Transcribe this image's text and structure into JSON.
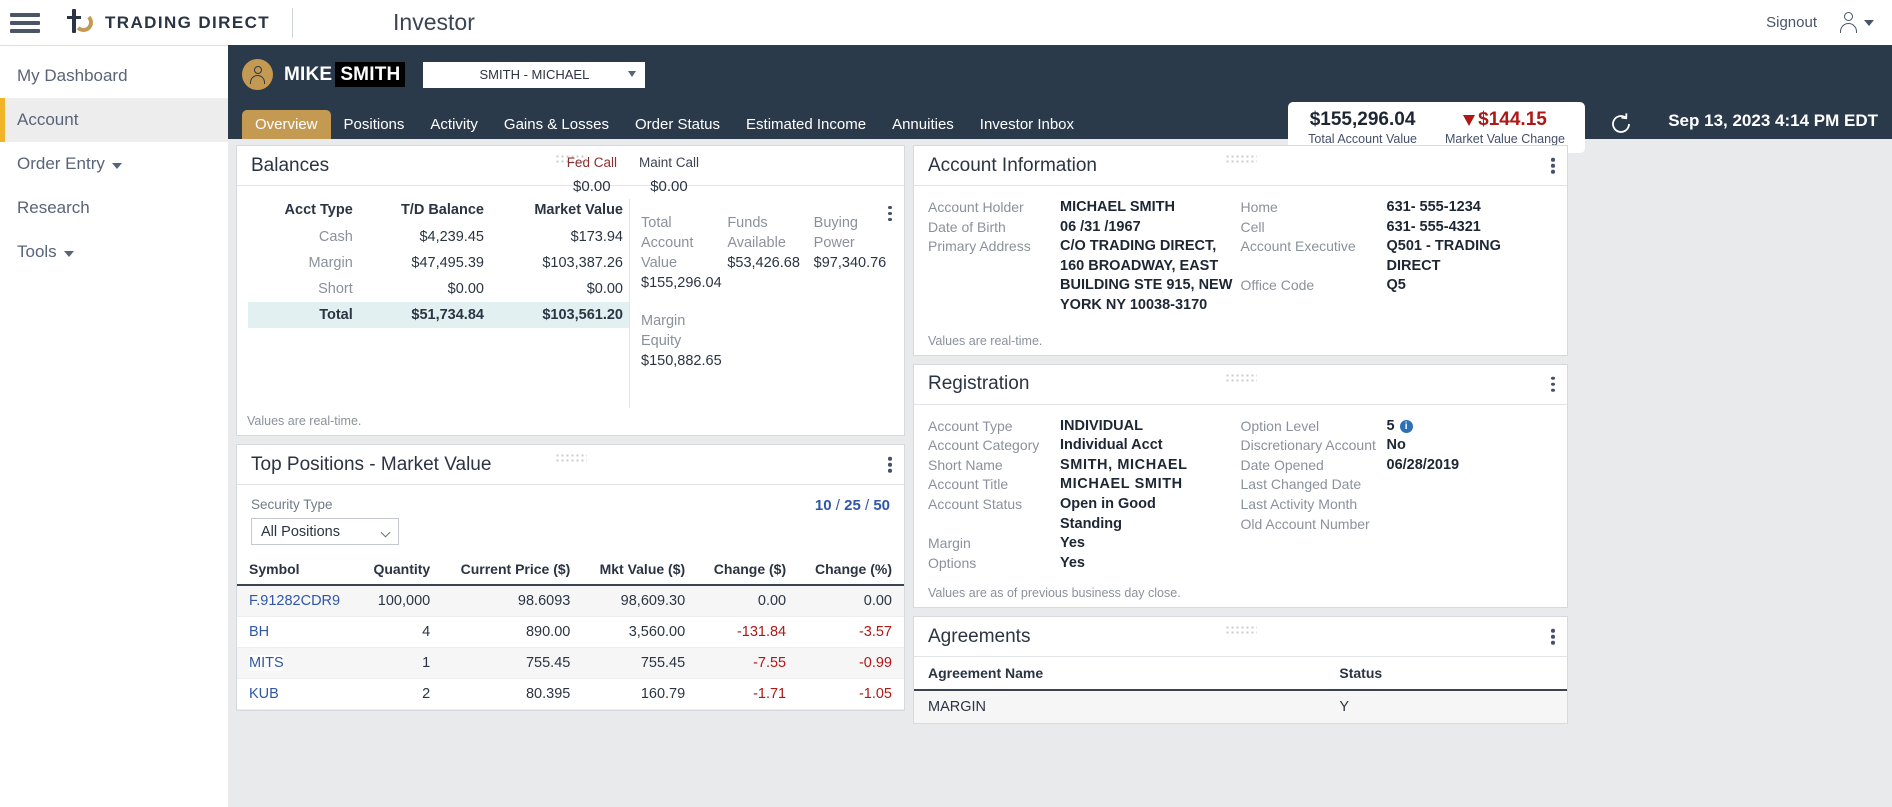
{
  "topbar": {
    "brand_name": "TRADING DIRECT",
    "app_title": "Investor",
    "signout_label": "Signout"
  },
  "sidebar": {
    "items": [
      {
        "label": "My Dashboard",
        "active": false,
        "caret": false
      },
      {
        "label": "Account",
        "active": true,
        "caret": false
      },
      {
        "label": "Order Entry",
        "active": false,
        "caret": true
      },
      {
        "label": "Research",
        "active": false,
        "caret": false
      },
      {
        "label": "Tools",
        "active": false,
        "caret": true
      }
    ]
  },
  "account_bar": {
    "name_first": "MIKE",
    "name_redacted": "SMITH",
    "account_select_value": "SMITH - MICHAEL",
    "total_account_value": "$155,296.04",
    "total_account_value_label": "Total Account Value",
    "market_value_change": "$144.15",
    "market_value_change_label": "Market Value Change",
    "timestamp": "Sep 13, 2023 4:14 PM EDT",
    "tabs": [
      {
        "label": "Overview",
        "active": true
      },
      {
        "label": "Positions",
        "active": false
      },
      {
        "label": "Activity",
        "active": false
      },
      {
        "label": "Gains & Losses",
        "active": false
      },
      {
        "label": "Order Status",
        "active": false
      },
      {
        "label": "Estimated Income",
        "active": false
      },
      {
        "label": "Annuities",
        "active": false
      },
      {
        "label": "Investor Inbox",
        "active": false
      }
    ]
  },
  "balances": {
    "title": "Balances",
    "fed_call_label": "Fed Call",
    "fed_call_value": "$0.00",
    "maint_call_label": "Maint Call",
    "maint_call_value": "$0.00",
    "columns": [
      "Acct Type",
      "T/D Balance",
      "Market Value"
    ],
    "rows": [
      {
        "type": "Cash",
        "td_balance": "$4,239.45",
        "market_value": "$173.94"
      },
      {
        "type": "Margin",
        "td_balance": "$47,495.39",
        "market_value": "$103,387.26"
      },
      {
        "type": "Short",
        "td_balance": "$0.00",
        "market_value": "$0.00"
      },
      {
        "type": "Total",
        "td_balance": "$51,734.84",
        "market_value": "$103,561.20"
      }
    ],
    "metrics": [
      {
        "label": "Total Account Value",
        "value": "$155,296.04"
      },
      {
        "label": "Funds Available",
        "value": "$53,426.68"
      },
      {
        "label": "Buying Power",
        "value": "$97,340.76"
      }
    ],
    "margin_equity_label": "Margin Equity",
    "margin_equity_value": "$150,882.65",
    "footnote": "Values are real-time."
  },
  "top_positions": {
    "title": "Top Positions - Market Value",
    "security_type_label": "Security Type",
    "security_type_value": "All Positions",
    "pager": {
      "p10": "10",
      "p25": "25",
      "p50": "50"
    },
    "columns": [
      "Symbol",
      "Quantity",
      "Current Price ($)",
      "Mkt Value ($)",
      "Change ($)",
      "Change (%)"
    ],
    "rows": [
      {
        "symbol": "F.91282CDR9",
        "quantity": "100,000",
        "price": "98.6093",
        "mkt_value": "98,609.30",
        "chg": "0.00",
        "chg_pct": "0.00",
        "neg": false
      },
      {
        "symbol": "BH",
        "quantity": "4",
        "price": "890.00",
        "mkt_value": "3,560.00",
        "chg": "-131.84",
        "chg_pct": "-3.57",
        "neg": true
      },
      {
        "symbol": "MITS",
        "quantity": "1",
        "price": "755.45",
        "mkt_value": "755.45",
        "chg": "-7.55",
        "chg_pct": "-0.99",
        "neg": true
      },
      {
        "symbol": "KUB",
        "quantity": "2",
        "price": "80.395",
        "mkt_value": "160.79",
        "chg": "-1.71",
        "chg_pct": "-1.05",
        "neg": true
      }
    ]
  },
  "account_information": {
    "title": "Account Information",
    "left": [
      {
        "key": "Account Holder",
        "value": "MICHAEL SMITH"
      },
      {
        "key": "Date of Birth",
        "value": "06 /31 /1967"
      },
      {
        "key": "Primary Address",
        "value": "C/O TRADING DIRECT, 160 BROADWAY, EAST BUILDING STE 915, NEW YORK NY 10038-3170"
      }
    ],
    "right": [
      {
        "key": "Home",
        "value": "631- 555-1234"
      },
      {
        "key": "Cell",
        "value": "631- 555-4321"
      },
      {
        "key": "Account Executive",
        "value": "Q501 - TRADING DIRECT"
      },
      {
        "key": "Office Code",
        "value": "Q5"
      }
    ],
    "footnote": "Values are real-time."
  },
  "registration": {
    "title": "Registration",
    "left": [
      {
        "key": "Account Type",
        "value": "INDIVIDUAL"
      },
      {
        "key": "Account Category",
        "value": "Individual Acct"
      },
      {
        "key": "Short Name",
        "value": "SMITH,  MICHAEL"
      },
      {
        "key": "Account Title",
        "value": "MICHAEL  SMITH"
      },
      {
        "key": "Account Status",
        "value": "Open in Good Standing"
      },
      {
        "key": "Margin",
        "value": "Yes"
      },
      {
        "key": "Options",
        "value": "Yes"
      }
    ],
    "right": [
      {
        "key": "Option Level",
        "value": "5",
        "info": true
      },
      {
        "key": "Discretionary Account",
        "value": "No"
      },
      {
        "key": "Date Opened",
        "value": "06/28/2019"
      },
      {
        "key": "Last Changed Date",
        "value": ""
      },
      {
        "key": "Last Activity Month",
        "value": ""
      },
      {
        "key": "Old Account Number",
        "value": ""
      }
    ],
    "footnote": "Values are as of previous business day close."
  },
  "agreements": {
    "title": "Agreements",
    "columns": [
      "Agreement Name",
      "Status"
    ],
    "rows": [
      {
        "name": "MARGIN",
        "status": "Y"
      }
    ]
  },
  "colors": {
    "brand_gold": "#c49a53",
    "header_navy": "#2b3a4a",
    "accent_yellow": "#f0b429",
    "link_blue": "#2f57a6",
    "negative_red": "#b01717"
  }
}
